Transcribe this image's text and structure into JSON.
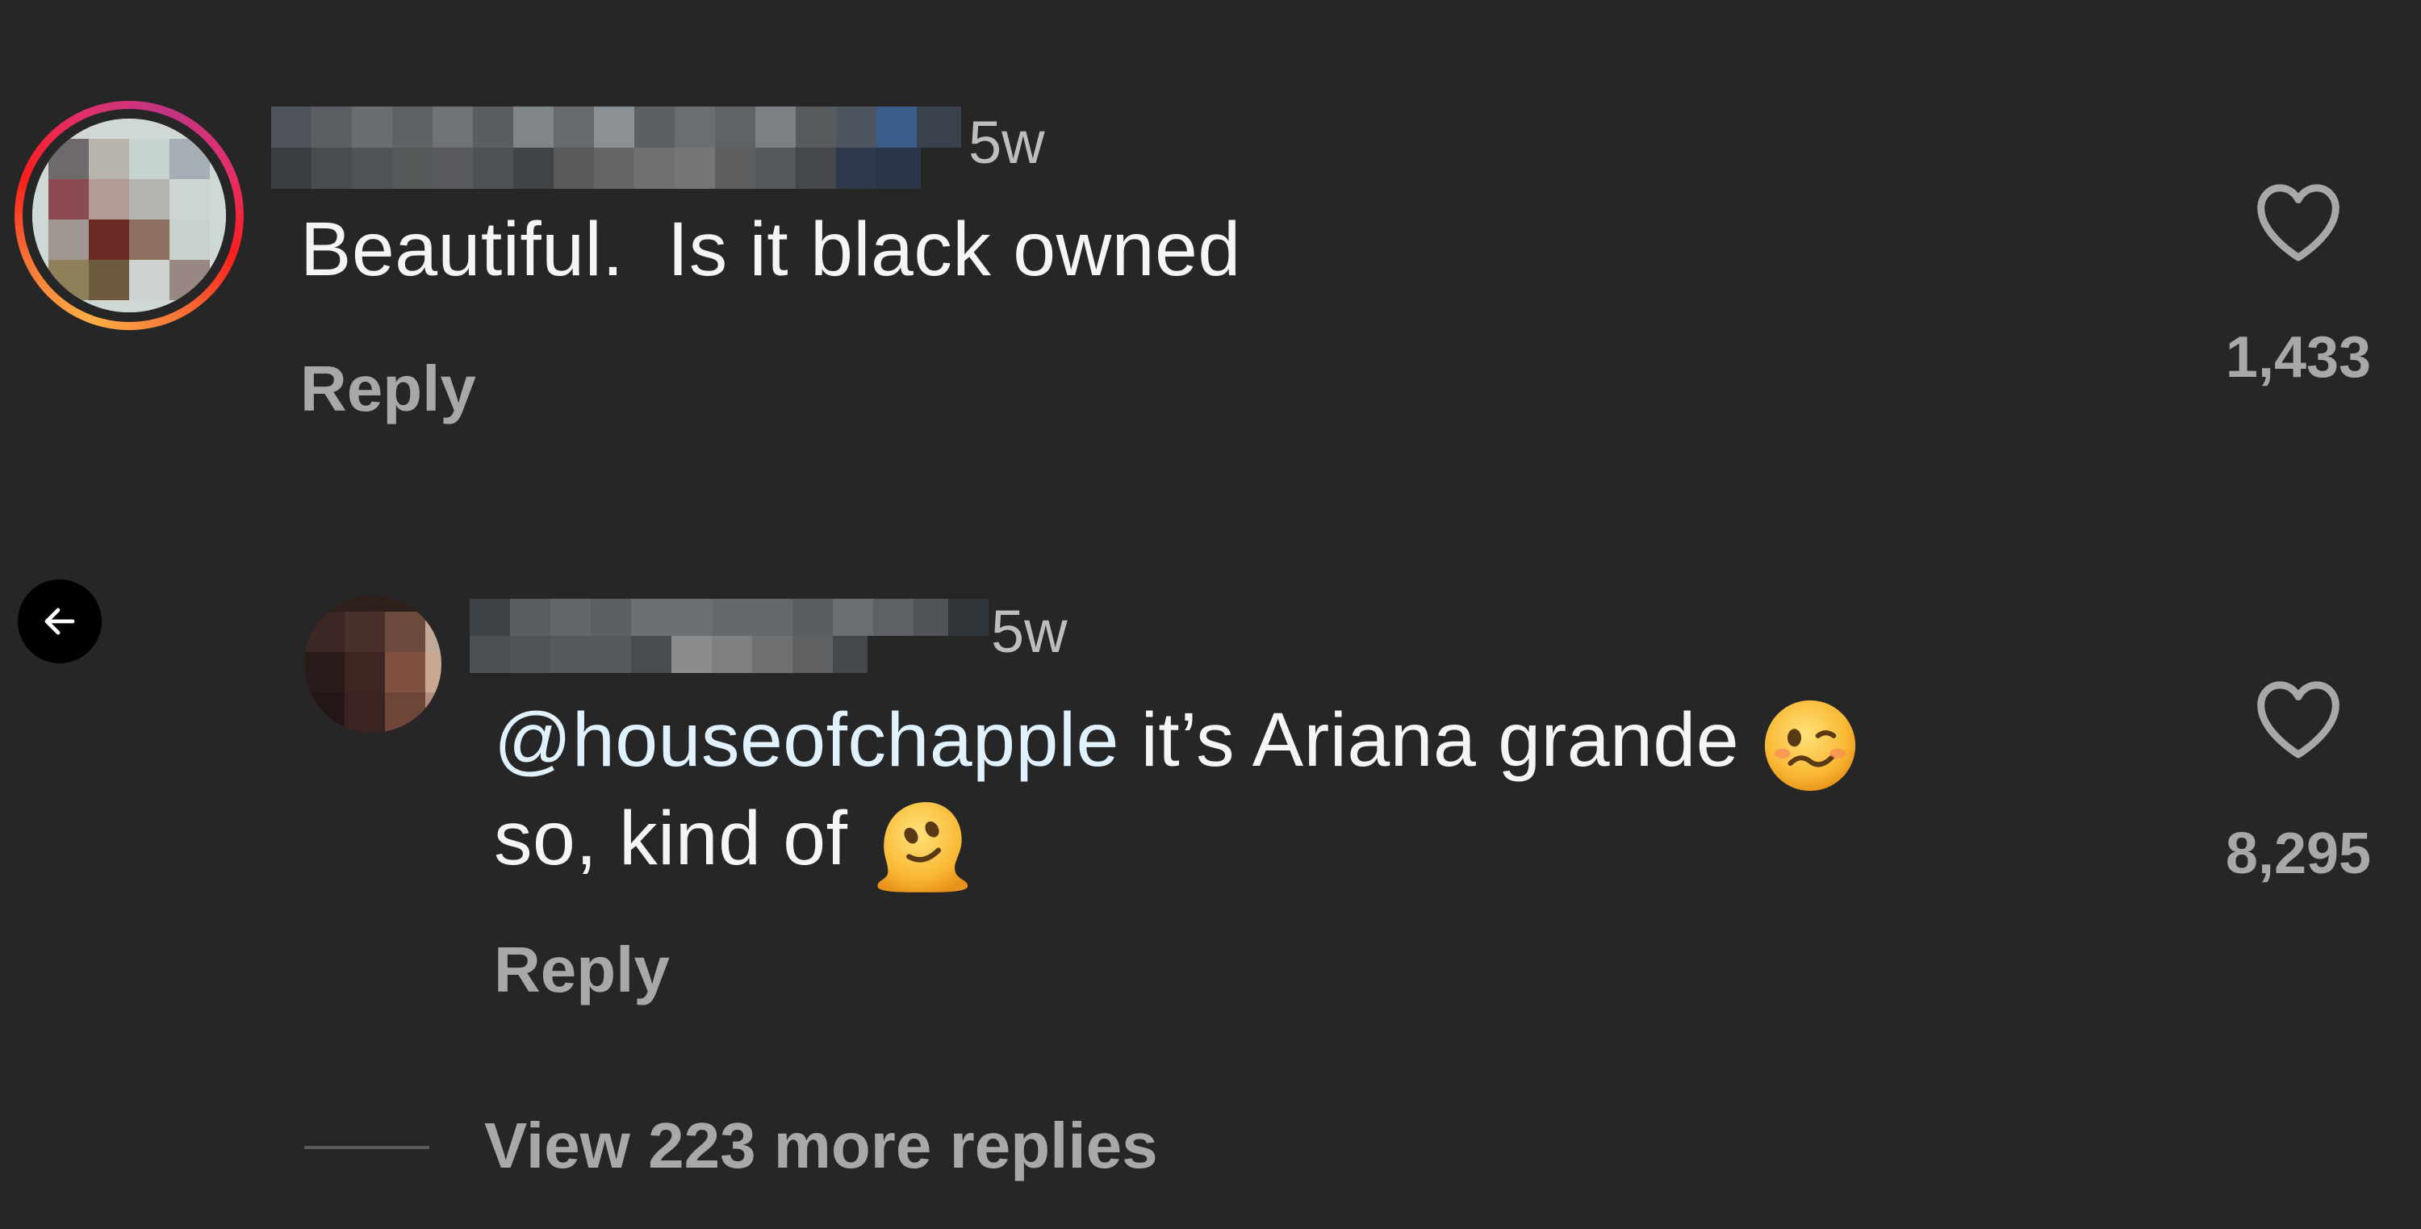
{
  "comment": {
    "time": "5w",
    "text": "Beautiful.  Is it black owned",
    "reply_label": "Reply",
    "like_count": "1,433"
  },
  "reply": {
    "time": "5w",
    "mention": "@houseofchapple",
    "text_line1": " it’s Ariana grande",
    "text_line2": "so, kind of",
    "emoji1": "woozy-face",
    "emoji2": "melting-face",
    "reply_label": "Reply",
    "like_count": "8,295"
  },
  "view_more_replies": "View 223 more replies",
  "icons": {
    "like": "heart-icon",
    "back": "arrow-left-icon"
  },
  "colors": {
    "background": "#262626",
    "text": "#f5f5f5",
    "muted": "#a8a8a8",
    "mention": "#e0f1ff"
  }
}
